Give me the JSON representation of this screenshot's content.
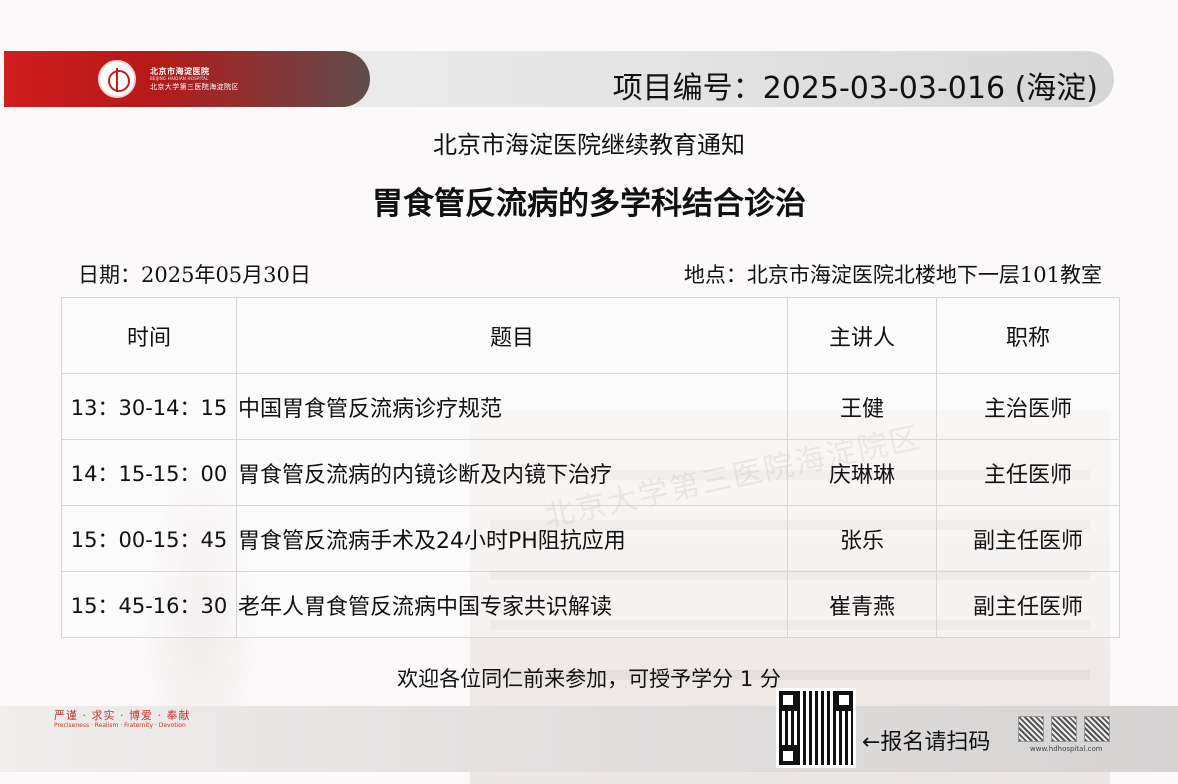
{
  "header": {
    "hospital_name_cn": "北京市海淀医院",
    "hospital_name_en": "BEIJING HAIDIAN HOSPITAL",
    "hospital_name_cn2": "北京大学第三医院海淀院区",
    "project_no": "项目编号：2025-03-03-016 (海淀)"
  },
  "notice_title": "北京市海淀医院继续教育通知",
  "topic_title": "胃食管反流病的多学科结合诊治",
  "date_line": "日期：2025年05月30日",
  "place_line": "地点：北京市海淀医院北楼地下一层101教室",
  "table": {
    "headers": [
      "时间",
      "题目",
      "主讲人",
      "职称"
    ],
    "rows": [
      {
        "time": "13：30-14：15",
        "topic": "中国胃食管反流病诊疗规范",
        "speaker": "王健",
        "title": "主治医师"
      },
      {
        "time": "14：15-15：00",
        "topic": "胃食管反流病的内镜诊断及内镜下治疗",
        "speaker": "庆琳琳",
        "title": "主任医师"
      },
      {
        "time": "15：00-15：45",
        "topic": "胃食管反流病手术及24小时PH阻抗应用",
        "speaker": "张乐",
        "title": "副主任医师"
      },
      {
        "time": "15：45-16：30",
        "topic": "老年人胃食管反流病中国专家共识解读",
        "speaker": "崔青燕",
        "title": "副主任医师"
      }
    ]
  },
  "welcome": "欢迎各位同仁前来参加，可授予学分 1 分",
  "footer": {
    "motto_cn": "严谨 · 求实 · 博爱 · 奉献",
    "motto_en": "Preciseness · Realism · Fraternity · Devotion",
    "scan_text": "←报名请扫码",
    "website": "www.hdhospital.com"
  },
  "watermark_text": "北京大学第三医院海淀院区",
  "colors": {
    "brand_red": "#c81d1d",
    "header_gray": "#e4e4e4"
  }
}
